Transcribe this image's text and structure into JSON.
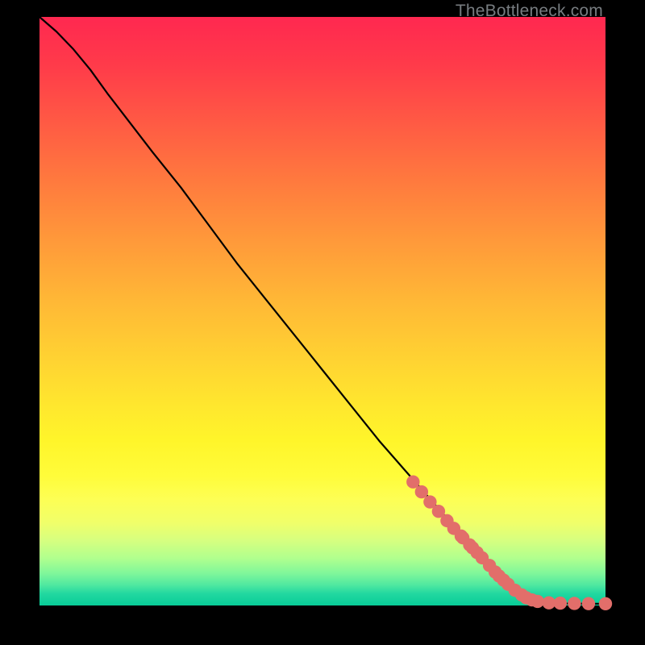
{
  "watermark": "TheBottleneck.com",
  "colors": {
    "curve": "#000000",
    "marker": "#e26e6a",
    "background_black": "#000000"
  },
  "chart_data": {
    "type": "line",
    "title": "",
    "xlabel": "",
    "ylabel": "",
    "xlim": [
      0,
      100
    ],
    "ylim": [
      0,
      100
    ],
    "series": [
      {
        "name": "curve",
        "x": [
          0,
          3,
          6,
          9,
          12,
          16,
          20,
          25,
          30,
          35,
          40,
          45,
          50,
          55,
          60,
          65,
          70,
          75,
          80,
          83,
          85,
          87,
          89,
          91,
          93,
          95,
          97,
          100
        ],
        "y": [
          100,
          97.5,
          94.5,
          91,
          87,
          82,
          77,
          71,
          64.5,
          58,
          52,
          46,
          40,
          34,
          28,
          22.5,
          17,
          11.5,
          6,
          3.3,
          2.0,
          1.2,
          0.7,
          0.45,
          0.35,
          0.32,
          0.3,
          0.3
        ]
      }
    ],
    "markers": {
      "name": "highlighted-points",
      "x": [
        66,
        67.5,
        69,
        70.5,
        72,
        73.2,
        74.5,
        74.8,
        76,
        76.5,
        77.3,
        78.2,
        79.5,
        80.5,
        81.2,
        82,
        82.8,
        84,
        85.2,
        86,
        87,
        88,
        90,
        92,
        94.5,
        97,
        100
      ],
      "y": [
        21,
        19.3,
        17.6,
        16,
        14.4,
        13.1,
        11.8,
        11.5,
        10.3,
        9.8,
        9,
        8.1,
        6.8,
        5.7,
        5,
        4.3,
        3.6,
        2.6,
        1.8,
        1.3,
        0.95,
        0.7,
        0.45,
        0.4,
        0.35,
        0.32,
        0.3
      ]
    }
  }
}
